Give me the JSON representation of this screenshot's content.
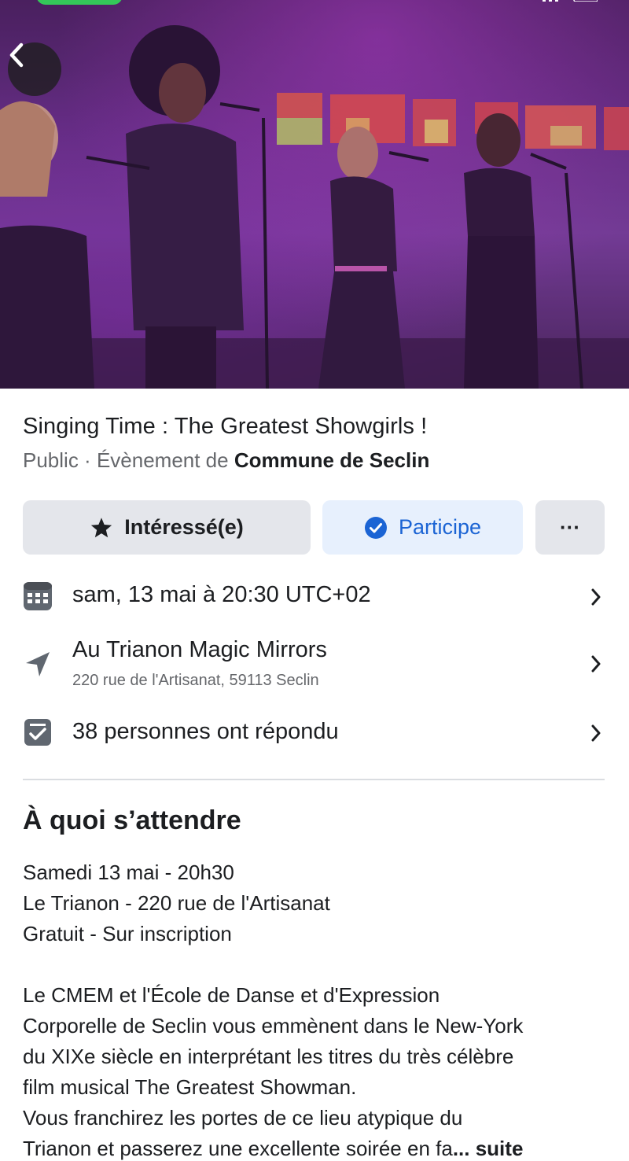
{
  "hero": {
    "back_icon": "chevron-left-icon",
    "image_subject": ""
  },
  "event": {
    "title": "Singing Time : The Greatest Showgirls !",
    "visibility": "Public",
    "separator": " · ",
    "organizer_prefix": "Évènement de ",
    "organizer": "Commune de Seclin"
  },
  "actions": {
    "interested_label": "Intéressé(e)",
    "interested_icon": "star-icon",
    "going_label": "Participe",
    "going_icon": "check-circle-icon",
    "more_label": "···",
    "accent_color": "#1b64d4"
  },
  "details": {
    "date": {
      "icon": "calendar-icon",
      "text": "sam, 13 mai à 20:30 UTC+02"
    },
    "location": {
      "icon": "location-arrow-icon",
      "name": "Au Trianon Magic Mirrors",
      "address": "220 rue de l'Artisanat, 59113 Seclin"
    },
    "responses": {
      "icon": "checklist-icon",
      "text": "38 personnes ont répondu"
    }
  },
  "about": {
    "heading": "À quoi s’attendre",
    "lines": [
      "Samedi 13 mai - 20h30",
      "Le Trianon - 220 rue de l'Artisanat",
      "Gratuit - Sur inscription"
    ],
    "paragraph": [
      "Le CMEM et l'École de Danse et d'Expression",
      "Corporelle de Seclin vous emmènent dans le New-York",
      "du XIXe siècle en interprétant les titres du très célèbre",
      "film musical The Greatest Showman.",
      "Vous franchirez les portes de ce lieu atypique du",
      "Trianon et passerez une excellente soirée en fa"
    ],
    "ellipsis": "... ",
    "see_more": "suite"
  }
}
